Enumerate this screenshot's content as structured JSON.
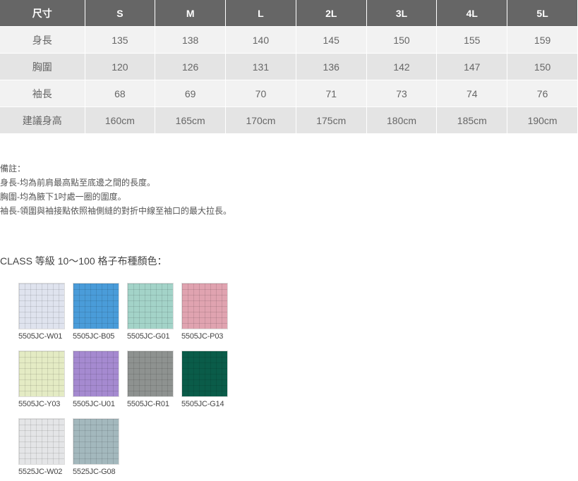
{
  "size_table": {
    "headers": [
      "尺寸",
      "S",
      "M",
      "L",
      "2L",
      "3L",
      "4L",
      "5L"
    ],
    "rows": [
      [
        "身長",
        "135",
        "138",
        "140",
        "145",
        "150",
        "155",
        "159"
      ],
      [
        "胸圍",
        "120",
        "126",
        "131",
        "136",
        "142",
        "147",
        "150"
      ],
      [
        "袖長",
        "68",
        "69",
        "70",
        "71",
        "73",
        "74",
        "76"
      ],
      [
        "建議身高",
        "160cm",
        "165cm",
        "170cm",
        "175cm",
        "180cm",
        "185cm",
        "190cm"
      ]
    ]
  },
  "notes": {
    "title": "備註：",
    "lines": [
      "身長-均為前肩最高點至底邊之間的長度。",
      "胸圍-均為腋下1吋處一圈的圍度。",
      "袖長-領圍與袖接點依照袖側縫的對折中線至袖口的最大拉長。"
    ]
  },
  "class_title": "CLASS 等級 10～100 格子布種顏色：",
  "swatches": [
    {
      "code": "5505JC-W01",
      "color": "#dfe3ee"
    },
    {
      "code": "5505JC-B05",
      "color": "#4a9cd9"
    },
    {
      "code": "5505JC-G01",
      "color": "#a3d3c8"
    },
    {
      "code": "5505JC-P03",
      "color": "#e0a3b0"
    },
    {
      "code": "5505JC-Y03",
      "color": "#e4ebc4"
    },
    {
      "code": "5505JC-U01",
      "color": "#a58ad0"
    },
    {
      "code": "5505JC-R01",
      "color": "#8e9290"
    },
    {
      "code": "5505JC-G14",
      "color": "#0a5c49"
    },
    {
      "code": "5525JC-W02",
      "color": "#e4e5e7"
    },
    {
      "code": "5525JC-G08",
      "color": "#a3b8bd"
    }
  ]
}
